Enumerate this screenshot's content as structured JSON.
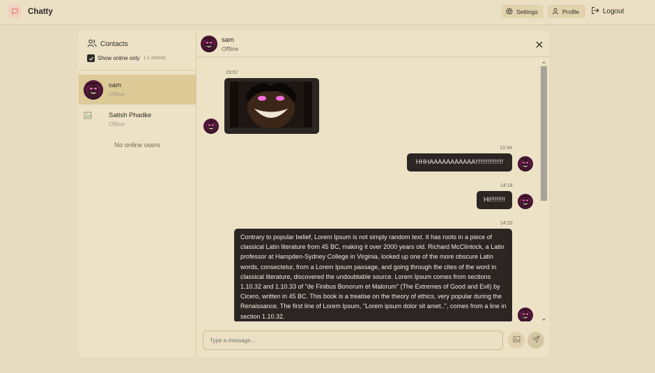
{
  "app": {
    "name": "Chatty"
  },
  "nav": {
    "settings": "Settings",
    "profile": "Profile",
    "logout": "Logout"
  },
  "sidebar": {
    "title": "Contacts",
    "show_online_label": "Show online only",
    "online_count": "(-1 online)",
    "contacts": [
      {
        "name": "sam",
        "status": "Offline"
      },
      {
        "name": "Satish Phadke",
        "status": "Offline"
      }
    ],
    "empty_text": "No online users"
  },
  "chat": {
    "user": {
      "name": "sam",
      "status": "Offline"
    },
    "messages": [
      {
        "time": "19:57",
        "type": "image",
        "side": "left"
      },
      {
        "time": "13:34",
        "text": "HHHAAAAAAAAAAA!!!!!!!!!!!!!!!!",
        "side": "right"
      },
      {
        "time": "14:19",
        "text": "Hi!!!!!!!!!",
        "side": "right"
      },
      {
        "time": "14:20",
        "text": "Contrary to popular belief, Lorem Ipsum is not simply random text. It has roots in a piece of classical Latin literature from 45 BC, making it over 2000 years old. Richard McClintock, a Latin professor at Hampden-Sydney College in Virginia, looked up one of the more obscure Latin words, consectetur, from a Lorem Ipsum passage, and going through the cites of the word in classical literature, discovered the undoubtable source. Lorem Ipsum comes from sections 1.10.32 and 1.10.33 of \"de Finibus Bonorum et Malorum\" (The Extremes of Good and Evil) by Cicero, written in 45 BC. This book is a treatise on the theory of ethics, very popular during the Renaissance. The first line of Lorem Ipsum, \"Lorem ipsum dolor sit amet..\", comes from a line in section 1.10.32.",
        "side": "right"
      }
    ],
    "input_placeholder": "Type a message..."
  },
  "icons": {
    "brand": "chat-bubble-icon",
    "settings": "gear-icon",
    "profile": "user-icon",
    "logout": "logout-icon",
    "contacts": "users-icon",
    "close": "close-icon",
    "image": "image-icon",
    "send": "send-icon"
  },
  "colors": {
    "background": "#e8dcc0",
    "bubble": "#2b2523",
    "active_contact": "#dcca97",
    "brand_accent": "#e0765a"
  }
}
